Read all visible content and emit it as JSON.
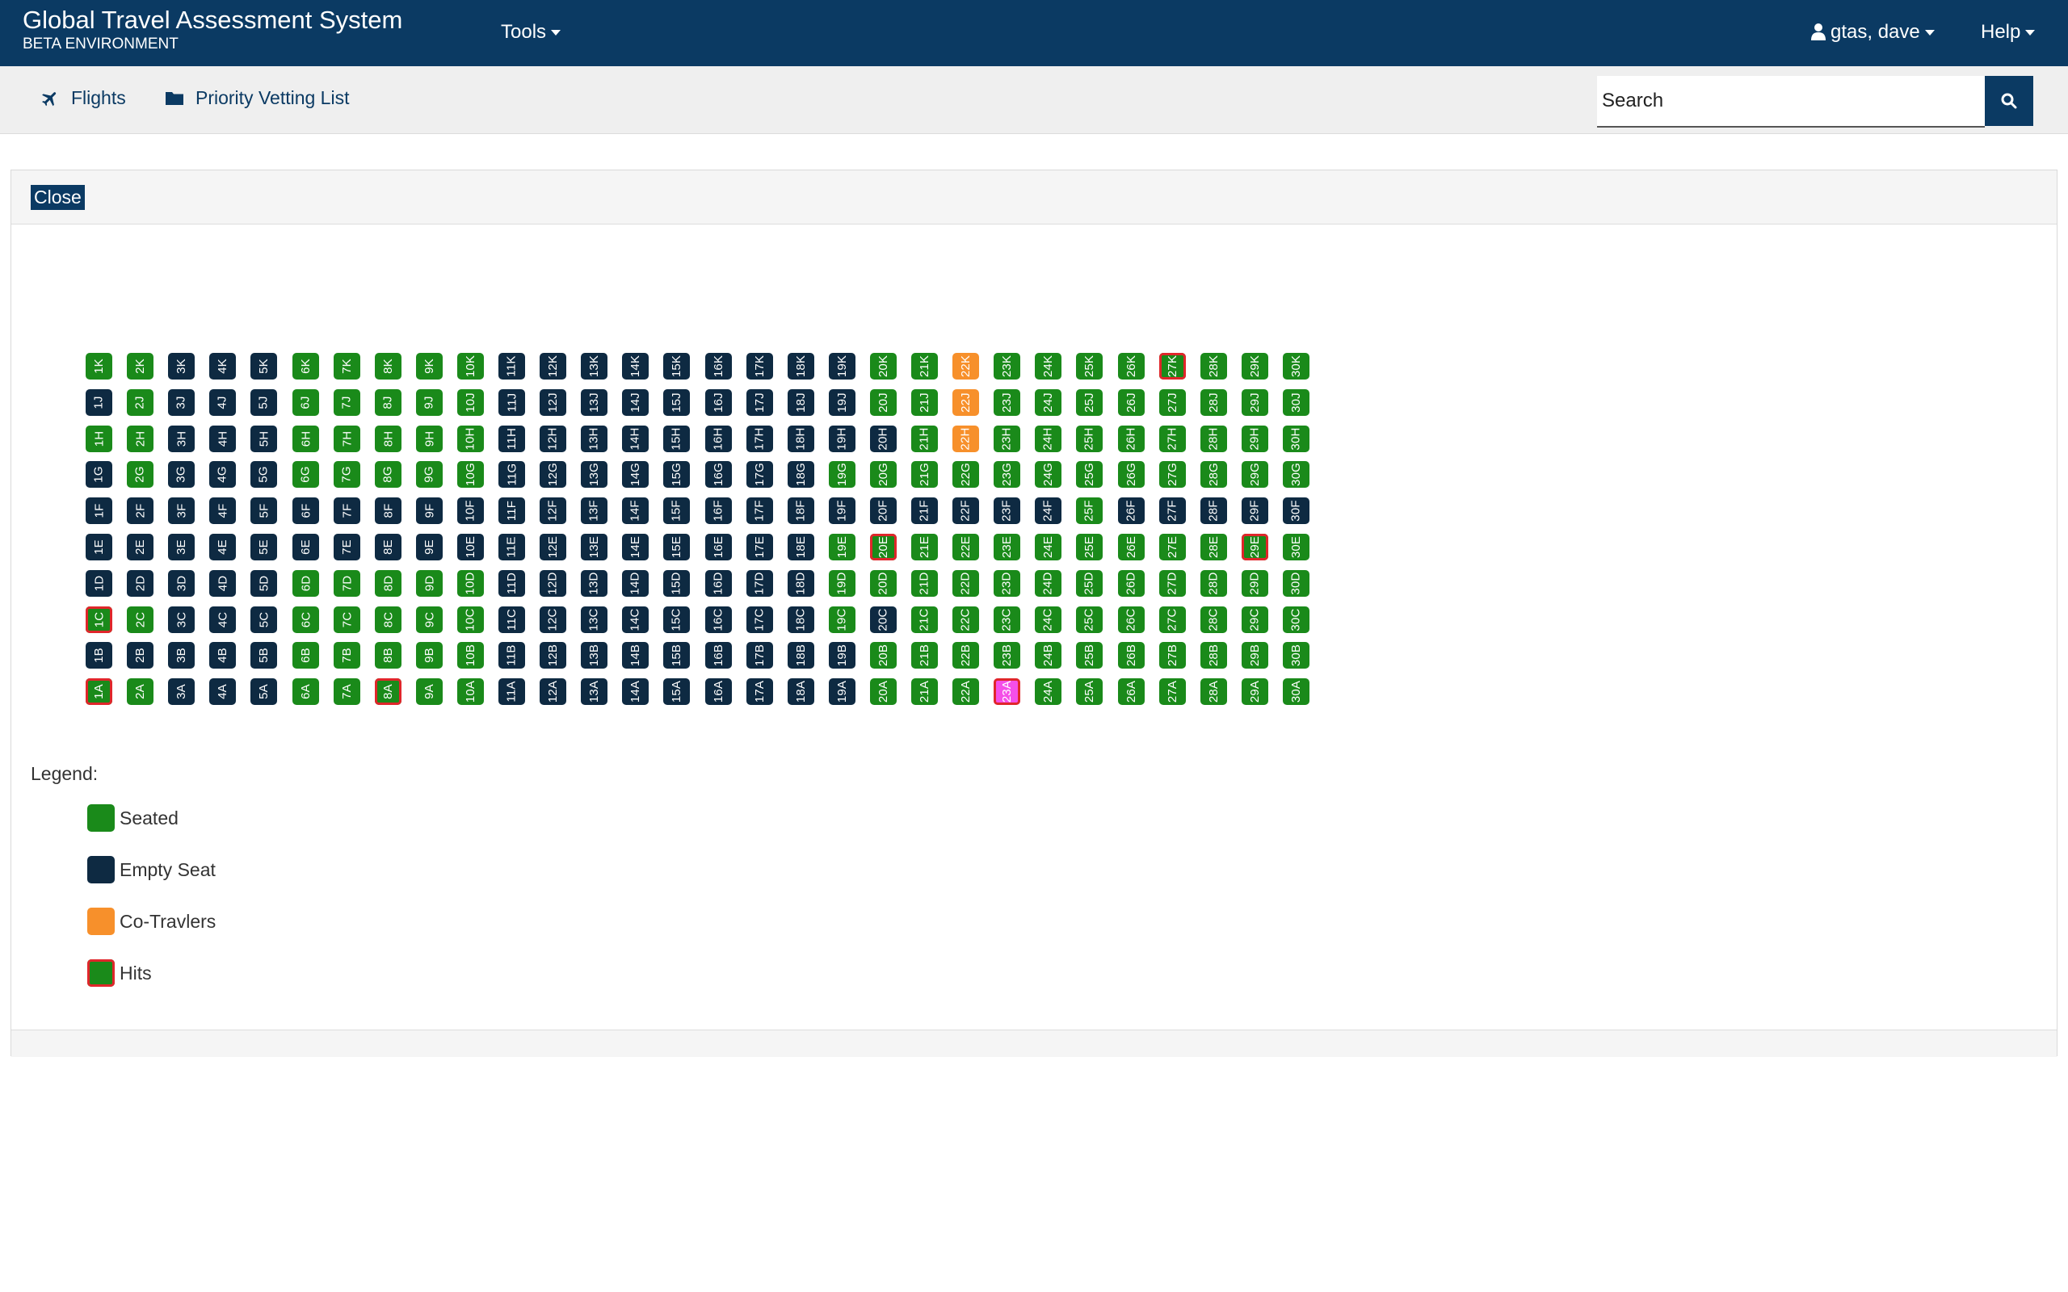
{
  "topbar": {
    "title": "Global Travel Assessment System",
    "subtitle": "BETA ENVIRONMENT",
    "tools_label": "Tools",
    "user_label": "gtas, dave",
    "help_label": "Help"
  },
  "subnav": {
    "flights_label": "Flights",
    "priority_label": "Priority Vetting List",
    "search_placeholder": "Search"
  },
  "panel": {
    "close_label": "Close"
  },
  "seatmap": {
    "rows": [
      "1",
      "2",
      "3",
      "4",
      "5",
      "6",
      "7",
      "8",
      "9",
      "10",
      "11",
      "12",
      "13",
      "14",
      "15",
      "16",
      "17",
      "18",
      "19",
      "20",
      "21",
      "22",
      "23",
      "24",
      "25",
      "26",
      "27",
      "28",
      "29",
      "30"
    ],
    "letters": [
      "K",
      "J",
      "H",
      "G",
      "F",
      "E",
      "D",
      "C",
      "B",
      "A"
    ],
    "status_codes": {
      "S": "seated",
      "E": "empty",
      "C": "cotraveler",
      "P": "pink"
    },
    "colors": {
      "seated": "#1a8a1a",
      "empty": "#0e2a42",
      "cotraveler": "#f7902b",
      "pink": "#f54fe8",
      "hit_border": "#e0262b"
    },
    "status": {
      "K": "SSEEESSSSSEEEEEEEEESSCSSSSSSSS",
      "J": "ESEEESSSSSEEEEEEEEESSCSSSSSSSS",
      "H": "SSEEESSSSSEEEEEEEEEESCSSSSSSSS",
      "G": "ESEEESSSSSEEEEEEEESSSSSSSSSSSS",
      "F": "EEEEEEEEEEEEEEEEEEEEEEEESEEEEE",
      "E": "EEEEEEEEEEEEEEEEEESSSSSSSSSSSS",
      "D": "EEEEESSSSSEEEEEEEESSSSSSSSSSSS",
      "C": "SSEEESSSSSEEEEEEEESESSSSSSSSSS",
      "B": "EEEEESSSSSEEEEEEEEESSSSSSSSSSS",
      "A": "SSEEESSSSSEEEEEEEEESSSPSSSSSSS"
    },
    "hits": [
      "27K",
      "20E",
      "29E",
      "1C",
      "1A",
      "8A",
      "23A"
    ]
  },
  "legend": {
    "label": "Legend:",
    "items": [
      {
        "label": "Seated",
        "color": "#1a8a1a",
        "hit": false
      },
      {
        "label": "Empty Seat",
        "color": "#0e2a42",
        "hit": false
      },
      {
        "label": "Co-Travlers",
        "color": "#f7902b",
        "hit": false
      },
      {
        "label": "Hits",
        "color": "#1a8a1a",
        "hit": true
      }
    ]
  }
}
